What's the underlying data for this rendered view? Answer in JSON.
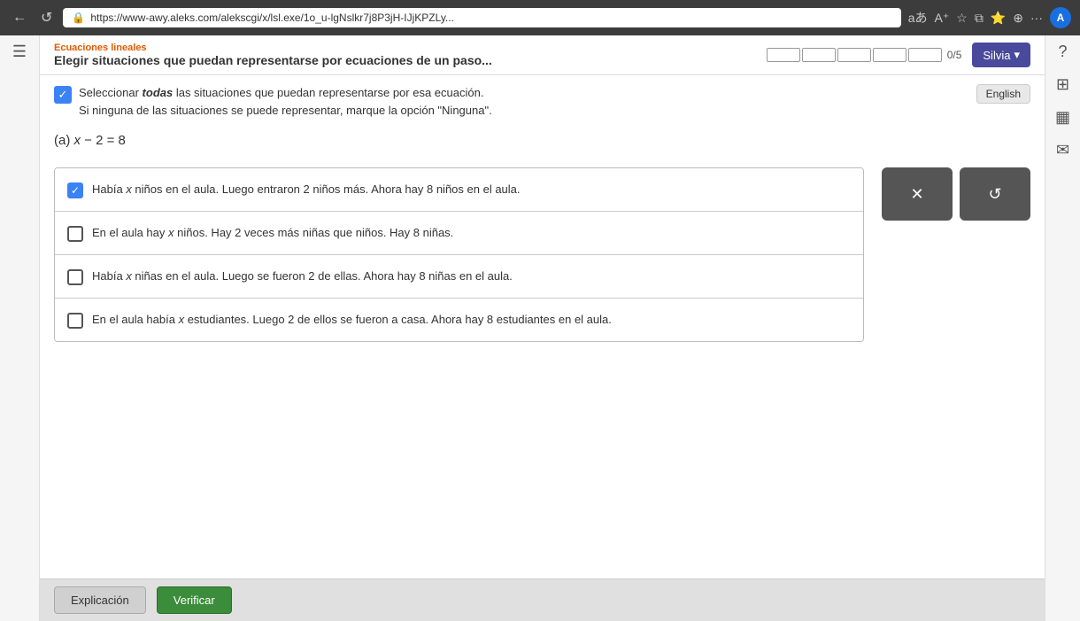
{
  "browser": {
    "url": "https://www-awy.aleks.com/alekscgi/x/lsl.exe/1o_u-lgNslkr7j8P3jH-IJjKPZLy...",
    "nav_back": "←",
    "nav_reload": "↺",
    "lock_icon": "🔒"
  },
  "header": {
    "topic_label": "Ecuaciones lineales",
    "topic_title": "Elegir situaciones que puedan representarse por ecuaciones de un paso...",
    "progress_filled": 0,
    "progress_total": 5,
    "progress_text": "0/5",
    "user_name": "Silvia",
    "user_chevron": "▾"
  },
  "instruction": {
    "text_part1": "Seleccionar ",
    "text_bold": "todas",
    "text_part2": " las situaciones que puedan representarse por esa ecuación.",
    "text_line2": "Si ninguna de las situaciones se puede representar, marque la opción \"Ninguna\".",
    "english_btn": "English"
  },
  "problem": {
    "label": "(a)",
    "equation": "x − 2 = 8",
    "choices": [
      {
        "id": "choice-1",
        "text": "Había x niños en el aula. Luego entraron 2 niños más. Ahora hay 8 niños en el aula.",
        "checked": true
      },
      {
        "id": "choice-2",
        "text": "En el aula hay x niños. Hay 2 veces más niñas que niños. Hay 8 niñas.",
        "checked": false
      },
      {
        "id": "choice-3",
        "text": "Había x niñas en el aula. Luego se fueron 2 de ellas. Ahora hay 8 niñas en el aula.",
        "checked": false
      },
      {
        "id": "choice-4",
        "text": "En el aula había x estudiantes. Luego 2 de ellos se fueron a casa. Ahora hay 8 estudiantes en el aula.",
        "checked": false
      }
    ],
    "btn_x": "✕",
    "btn_undo": "↺"
  },
  "bottom": {
    "explain_btn": "Explicación",
    "verify_btn": "Verificar"
  },
  "right_sidebar": {
    "question_mark": "?",
    "grid_icon": "⊞",
    "table_icon": "▦",
    "mail_icon": "✉"
  }
}
